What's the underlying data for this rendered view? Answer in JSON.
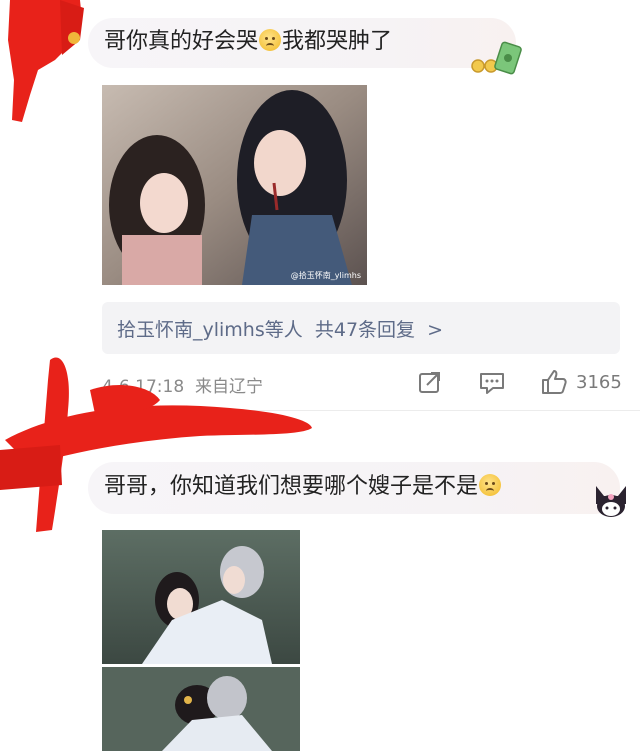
{
  "comment1": {
    "text_before": "哥你真的好会哭",
    "text_after": "我都哭肿了",
    "image_watermark": "@拾玉怀南_ylimhs",
    "replies": {
      "user": "拾玉怀南_ylimhs",
      "suffix": "等人",
      "count_text": "共47条回复",
      "chevron": ">"
    },
    "date": "4-6 17:18",
    "location": "来自辽宁",
    "likes": "3165"
  },
  "comment2": {
    "text_before": "哥哥，你知道我们想要哪个嫂子是不是"
  },
  "icons": [
    "money-badge-icon",
    "share-icon",
    "comment-icon",
    "like-icon",
    "kuromi-badge-icon",
    "sad-face-emoji"
  ],
  "colors": {
    "redaction": "#e8221a",
    "reply_link": "#5e6b88",
    "meta_gray": "#8a8a8a"
  }
}
